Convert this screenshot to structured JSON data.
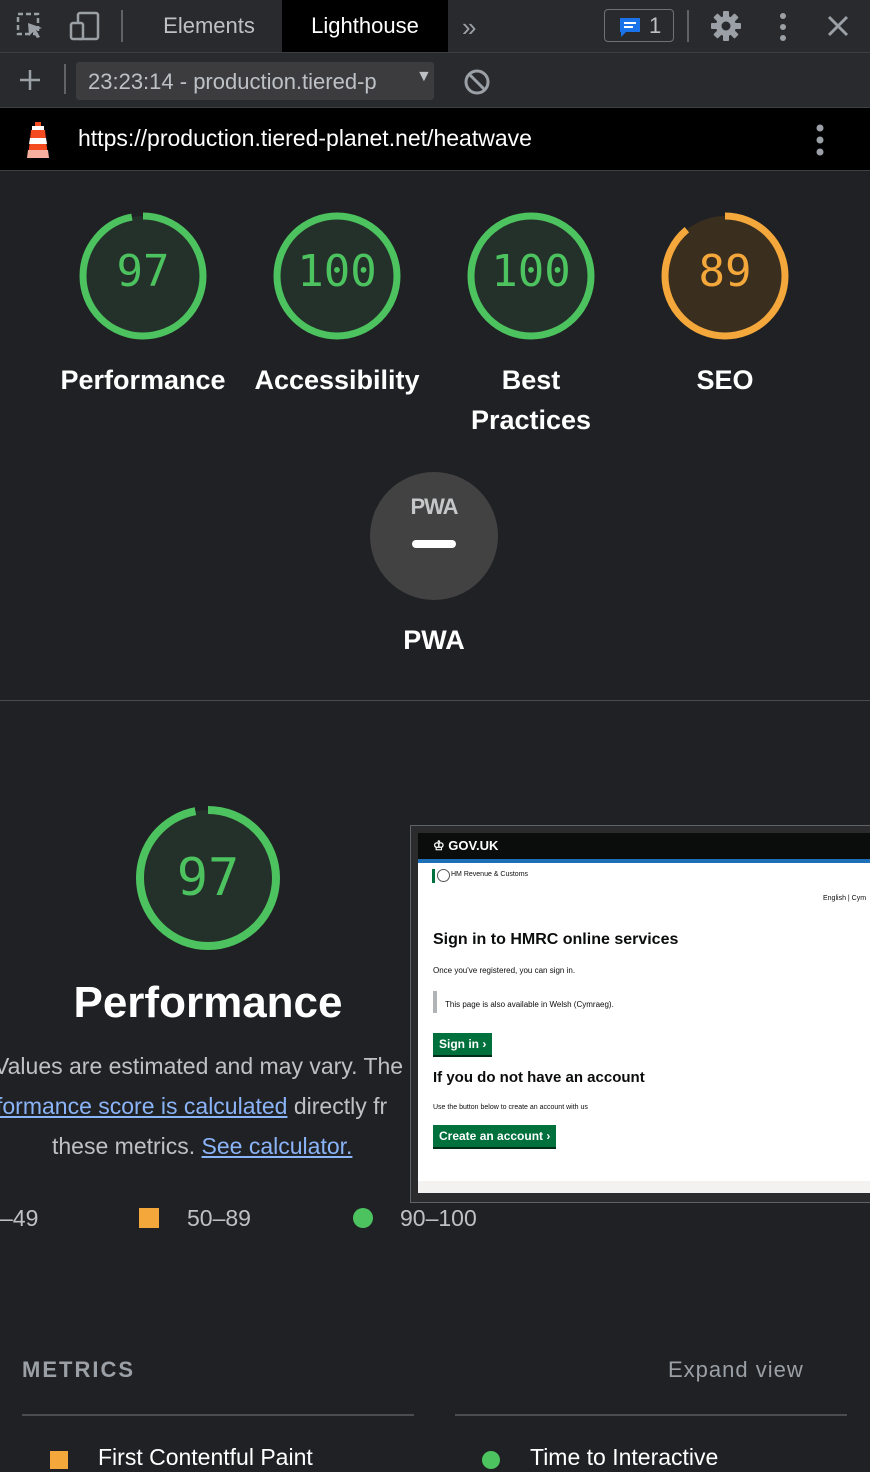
{
  "devtools": {
    "tabs": [
      "Elements",
      "Lighthouse"
    ],
    "active_tab": "Lighthouse",
    "message_count": "1",
    "report_selector": "23:23:14 - production.tiered-p",
    "url": "https://production.tiered-planet.net/heatwave"
  },
  "colors": {
    "pass": "#0cce6b",
    "average": "#ffa400",
    "pass_ring": "#4cc35f",
    "avg_ring": "#f4a73a"
  },
  "gauges": [
    {
      "score": "97",
      "label": "Performance",
      "status": "pass"
    },
    {
      "score": "100",
      "label": "Accessibility",
      "status": "pass"
    },
    {
      "score": "100",
      "label": "Best Practices",
      "label_line1": "Best",
      "label_line2": "Practices",
      "status": "pass"
    },
    {
      "score": "89",
      "label": "SEO",
      "status": "average"
    }
  ],
  "pwa": {
    "badge": "PWA",
    "label": "PWA"
  },
  "performance": {
    "score": "97",
    "title": "Performance",
    "desc_line1": "Values are estimated and may vary. The",
    "desc_link1": "formance score is calculated",
    "desc_line2_rest": " directly fr",
    "desc_line3": "these metrics.",
    "desc_link2": "See calculator."
  },
  "legend": [
    {
      "range": "–49",
      "shape": "triangle",
      "color": "red"
    },
    {
      "range": "50–89",
      "shape": "square",
      "color": "orange"
    },
    {
      "range": "90–100",
      "shape": "circle",
      "color": "green"
    }
  ],
  "screenshot": {
    "brand": "GOV.UK",
    "dept": "HM Revenue & Customs",
    "lang": "English | Cym",
    "heading": "Sign in to HMRC online services",
    "intro": "Once you've registered, you can sign in.",
    "inset": "This page is also available in Welsh (Cymraeg).",
    "signin": "Sign in",
    "heading2": "If you do not have an account",
    "intro2": "Use the button below to create an account with us",
    "create": "Create an account"
  },
  "metrics": {
    "heading": "METRICS",
    "expand": "Expand view",
    "items": [
      {
        "label": "First Contentful Paint",
        "status": "average"
      },
      {
        "label": "Time to Interactive",
        "status": "pass"
      }
    ]
  }
}
